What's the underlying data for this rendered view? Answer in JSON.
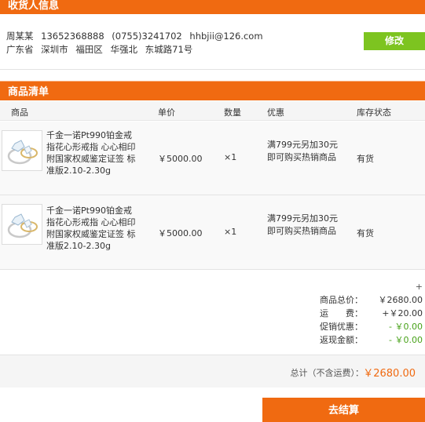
{
  "receiver": {
    "title": "收货人信息",
    "name": "周某某",
    "mobile": "13652368888",
    "phone": "(0755)3241702",
    "email": "hhbjii@126.com",
    "province": "广东省",
    "city": "深圳市",
    "district": "福田区",
    "area": "华强北",
    "street": "东城路71号",
    "edit_label": "修改"
  },
  "goods": {
    "title": "商品清单",
    "columns": [
      "商品",
      "单价",
      "数量",
      "优惠",
      "库存状态"
    ],
    "items": [
      {
        "name": "千金一诺Pt990铂金戒指花心形戒指 心心相印 附国家权威鉴定证签 标准版2.10-2.30g",
        "price": "￥5000.00",
        "qty": "×1",
        "promo": "满799元另加30元即可购买热销商品",
        "stock": "有货"
      },
      {
        "name": "千金一诺Pt990铂金戒指花心形戒指 心心相印 附国家权威鉴定证签 标准版2.10-2.30g",
        "price": "￥5000.00",
        "qty": "×1",
        "promo": "满799元另加30元即可购买热销商品",
        "stock": "有货"
      }
    ]
  },
  "summary": {
    "plus": "+",
    "goods_total_label": "商品总价：",
    "goods_total": "￥2680.00",
    "shipping_label": "运　　费：",
    "shipping": "+￥20.00",
    "promo_label": "促销优惠：",
    "promo": "- ￥0.00",
    "cashback_label": "返现金额：",
    "cashback": "- ￥0.00"
  },
  "total": {
    "label": "总计（不含运费）：",
    "value": "￥2680.00"
  },
  "checkout_label": "去结算",
  "colors": {
    "accent": "#f06a11",
    "edit_button": "#7dc420",
    "discount_green": "#48a21a"
  }
}
